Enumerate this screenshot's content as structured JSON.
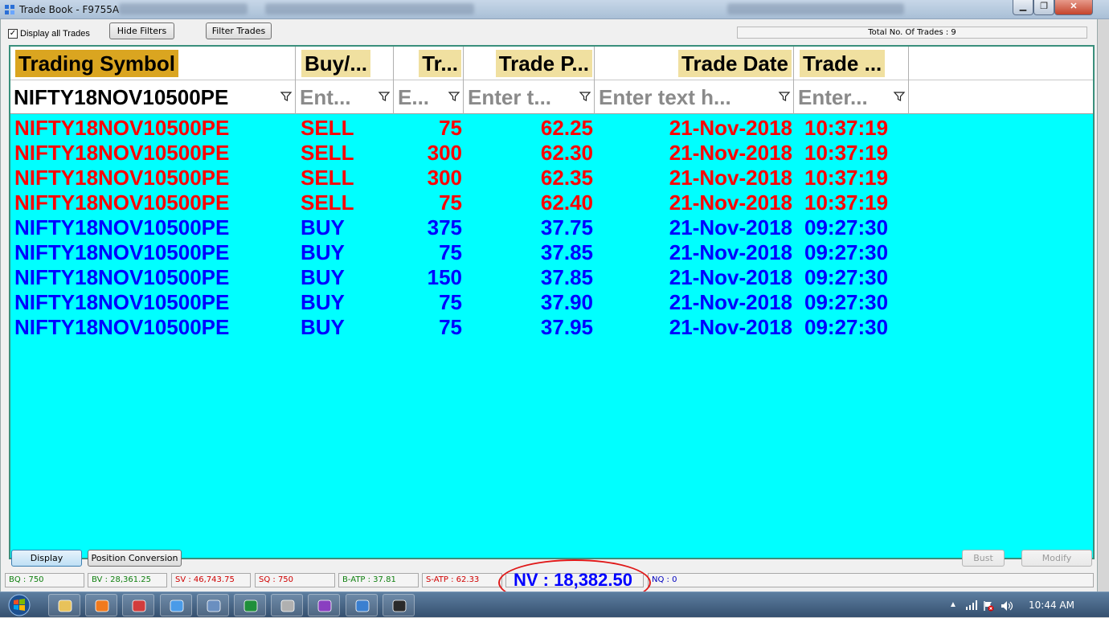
{
  "window": {
    "title": "Trade Book - F9755A",
    "minimize_glyph": "▁",
    "maximize_glyph": "❐",
    "close_glyph": "✕"
  },
  "toolbar": {
    "display_all_label": "Display all Trades",
    "display_all_checked": true,
    "hide_filters_label": "Hide Filters",
    "filter_trades_label": "Filter Trades",
    "total_trades_text": "Total No. Of Trades : 9"
  },
  "columns": [
    {
      "header": "Trading Symbol",
      "header_bg": "#daa520",
      "filter_value": "NIFTY18NOV10500PE",
      "filter_is_placeholder": false
    },
    {
      "header": "Buy/...",
      "header_bg": "#f0e0a0",
      "filter_value": "Ent...",
      "filter_is_placeholder": true
    },
    {
      "header": "Tr...",
      "header_bg": "#f0e0a0",
      "filter_value": "E...",
      "filter_is_placeholder": true
    },
    {
      "header": "Trade P...",
      "header_bg": "#f0e0a0",
      "filter_value": "Enter t...",
      "filter_is_placeholder": true
    },
    {
      "header": "Trade Date",
      "header_bg": "#f0e0a0",
      "filter_value": "Enter text h...",
      "filter_is_placeholder": true
    },
    {
      "header": "Trade ...",
      "header_bg": "#f0e0a0",
      "filter_value": "Enter...",
      "filter_is_placeholder": true
    }
  ],
  "trades": [
    {
      "symbol": "NIFTY18NOV10500PE",
      "side": "SELL",
      "qty": "75",
      "price": "62.25",
      "date": "21-Nov-2018",
      "time": "10:37:19"
    },
    {
      "symbol": "NIFTY18NOV10500PE",
      "side": "SELL",
      "qty": "300",
      "price": "62.30",
      "date": "21-Nov-2018",
      "time": "10:37:19"
    },
    {
      "symbol": "NIFTY18NOV10500PE",
      "side": "SELL",
      "qty": "300",
      "price": "62.35",
      "date": "21-Nov-2018",
      "time": "10:37:19"
    },
    {
      "symbol": "NIFTY18NOV10500PE",
      "side": "SELL",
      "qty": "75",
      "price": "62.40",
      "date": "21-Nov-2018",
      "time": "10:37:19"
    },
    {
      "symbol": "NIFTY18NOV10500PE",
      "side": "BUY",
      "qty": "375",
      "price": "37.75",
      "date": "21-Nov-2018",
      "time": "09:27:30"
    },
    {
      "symbol": "NIFTY18NOV10500PE",
      "side": "BUY",
      "qty": "75",
      "price": "37.85",
      "date": "21-Nov-2018",
      "time": "09:27:30"
    },
    {
      "symbol": "NIFTY18NOV10500PE",
      "side": "BUY",
      "qty": "150",
      "price": "37.85",
      "date": "21-Nov-2018",
      "time": "09:27:30"
    },
    {
      "symbol": "NIFTY18NOV10500PE",
      "side": "BUY",
      "qty": "75",
      "price": "37.90",
      "date": "21-Nov-2018",
      "time": "09:27:30"
    },
    {
      "symbol": "NIFTY18NOV10500PE",
      "side": "BUY",
      "qty": "75",
      "price": "37.95",
      "date": "21-Nov-2018",
      "time": "09:27:30"
    }
  ],
  "colors": {
    "sell": "#ff0000",
    "buy": "#0000ff",
    "grid_bg": "#00ffff"
  },
  "bottom": {
    "display_label": "Display",
    "position_conversion_label": "Position Conversion",
    "bust_label": "Bust",
    "modify_label": "Modify"
  },
  "status": {
    "bq": "BQ : 750",
    "bv": "BV : 28,361.25",
    "sv": "SV : 46,743.75",
    "sq": "SQ : 750",
    "batp": "B-ATP : 37.81",
    "satp": "S-ATP : 62.33",
    "nv": "NV : 18,382.50",
    "nq": "NQ : 0"
  },
  "taskbar": {
    "clock": "10:44 AM",
    "items": [
      "explorer-icon",
      "media-player-icon",
      "lifebuoy-icon",
      "chrome-icon",
      "window-icon",
      "excel-icon",
      "calculator-icon",
      "triangle-app-icon",
      "screen-app-icon",
      "chart-app-icon"
    ]
  }
}
